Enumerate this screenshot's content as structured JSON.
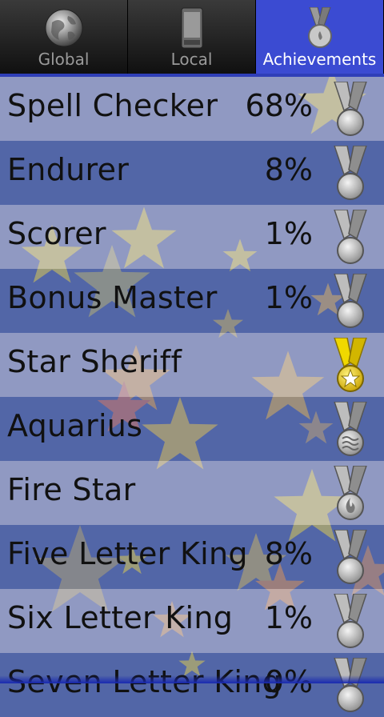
{
  "tabs": [
    {
      "label": "Global",
      "icon": "globe-icon",
      "active": false
    },
    {
      "label": "Local",
      "icon": "phone-icon",
      "active": false
    },
    {
      "label": "Achievements",
      "icon": "medal-icon",
      "active": true
    }
  ],
  "achievements": [
    {
      "name": "Spell Checker",
      "percent": "68%",
      "medal": "silver-plain"
    },
    {
      "name": "Endurer",
      "percent": "8%",
      "medal": "silver-plain"
    },
    {
      "name": "Scorer",
      "percent": "1%",
      "medal": "silver-plain"
    },
    {
      "name": "Bonus Master",
      "percent": "1%",
      "medal": "silver-plain"
    },
    {
      "name": "Star Sheriff",
      "percent": "",
      "medal": "gold-star"
    },
    {
      "name": "Aquarius",
      "percent": "",
      "medal": "silver-wave"
    },
    {
      "name": "Fire Star",
      "percent": "",
      "medal": "silver-flame"
    },
    {
      "name": "Five Letter King",
      "percent": "8%",
      "medal": "silver-plain"
    },
    {
      "name": "Six Letter King",
      "percent": "1%",
      "medal": "silver-plain"
    },
    {
      "name": "Seven Letter King",
      "percent": "0%",
      "medal": "silver-plain"
    }
  ],
  "colors": {
    "active_tab": "#3b4bd2",
    "silver_medal": "#b9b9b9",
    "gold_medal": "#e8c400",
    "star_yellow": "#f2dc4a",
    "star_orange": "#f0a050"
  }
}
